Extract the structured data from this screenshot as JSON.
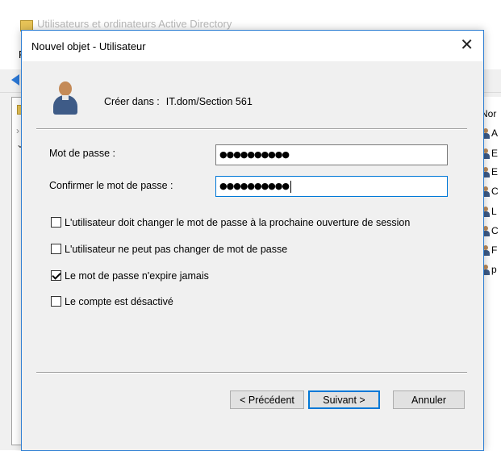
{
  "background_window": {
    "title": "Utilisateurs et ordinateurs Active Directory",
    "menu_letter": "F",
    "list_header": "Nor",
    "list_letters": [
      "A",
      "E",
      "E",
      "C",
      "L",
      "C",
      "F",
      "p"
    ]
  },
  "dialog": {
    "title": "Nouvel objet - Utilisateur",
    "close_glyph": "✕",
    "create_in_label": "Créer dans :",
    "create_in_value": "IT.dom/Section 561",
    "password_label": "Mot de passe :",
    "password_value": "●●●●●●●●●●",
    "confirm_label": "Confirmer le mot de passe :",
    "confirm_value": "●●●●●●●●●●",
    "checkboxes": [
      {
        "label": "L'utilisateur doit changer le mot de passe à la prochaine ouverture de session",
        "checked": false
      },
      {
        "label": "L'utilisateur ne peut pas changer de mot de passe",
        "checked": false
      },
      {
        "label": "Le mot de passe n'expire jamais",
        "checked": true
      },
      {
        "label": "Le compte est désactivé",
        "checked": false
      }
    ],
    "buttons": {
      "back": "< Précédent",
      "next": "Suivant >",
      "cancel": "Annuler"
    }
  },
  "colors": {
    "accent": "#0078d7",
    "dialog_bg": "#f0f0f0"
  }
}
